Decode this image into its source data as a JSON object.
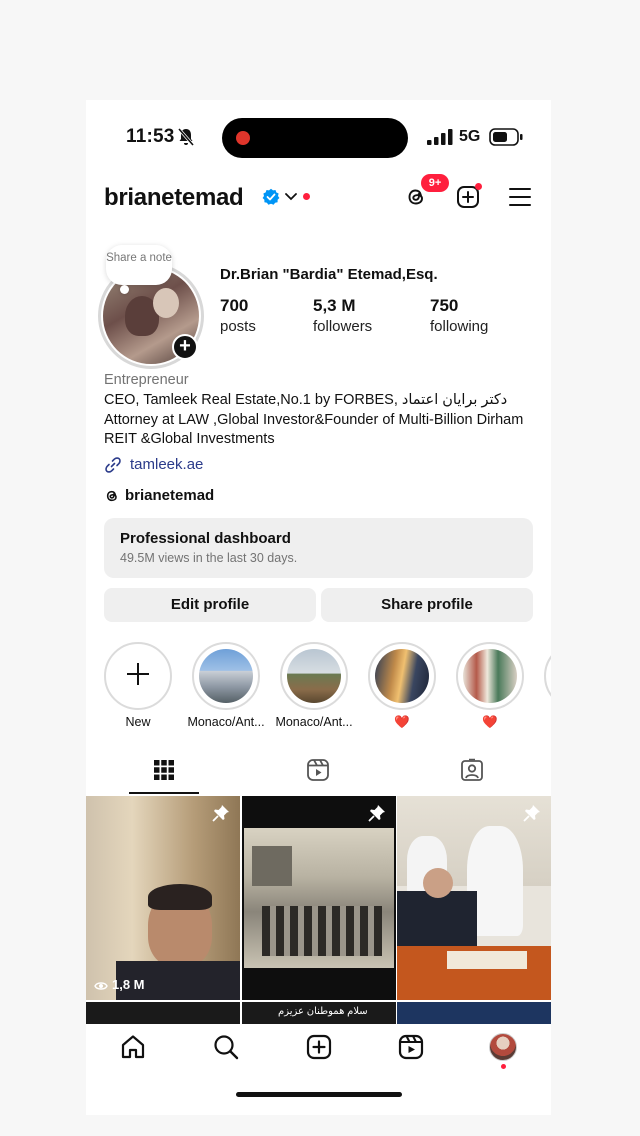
{
  "status_bar": {
    "time": "11:53",
    "network": "5G",
    "icons": [
      "bell-muted-icon",
      "signal-icon",
      "battery-icon"
    ],
    "recording_color": "#e0352b"
  },
  "header": {
    "username": "brianetemad",
    "threads_badge": "9+",
    "icons": [
      "verified-icon",
      "chevron-down-icon",
      "threads-icon",
      "add-post-icon",
      "menu-icon"
    ],
    "accent": "#ff1f3d",
    "verified_color": "#0095f6"
  },
  "profile": {
    "note": "Share a note",
    "full_name": "Dr.Brian \"Bardia\" Etemad,Esq.",
    "stats": [
      {
        "value": "700",
        "label": "posts"
      },
      {
        "value": "5,3 M",
        "label": "followers"
      },
      {
        "value": "750",
        "label": "following"
      }
    ],
    "category": "Entrepreneur",
    "bio": "CEO, Tamleek Real Estate,No.1 by FORBES, دکتر برایان اعتماد Attorney at LAW ,Global Investor&Founder of Multi-Billion Dirham REIT &Global Investments",
    "link": "tamleek.ae",
    "threads_handle": "brianetemad"
  },
  "dashboard": {
    "title": "Professional dashboard",
    "subtitle": "49.5M views in the last 30 days."
  },
  "buttons": {
    "edit": "Edit profile",
    "share": "Share profile"
  },
  "highlights": [
    {
      "label": "New"
    },
    {
      "label": "Monaco/Ant..."
    },
    {
      "label": "Monaco/Ant..."
    },
    {
      "label": "❤️"
    },
    {
      "label": "❤️"
    }
  ],
  "tabs": [
    "grid-icon",
    "reels-icon",
    "tagged-icon"
  ],
  "posts": [
    {
      "views": "1,8 M",
      "pinned": true
    },
    {
      "pinned": true,
      "caption": "سلام هموطنان عزیزم"
    },
    {
      "pinned": true
    }
  ],
  "bottom_nav": [
    "home-icon",
    "search-icon",
    "create-icon",
    "reels-icon",
    "profile-avatar"
  ]
}
